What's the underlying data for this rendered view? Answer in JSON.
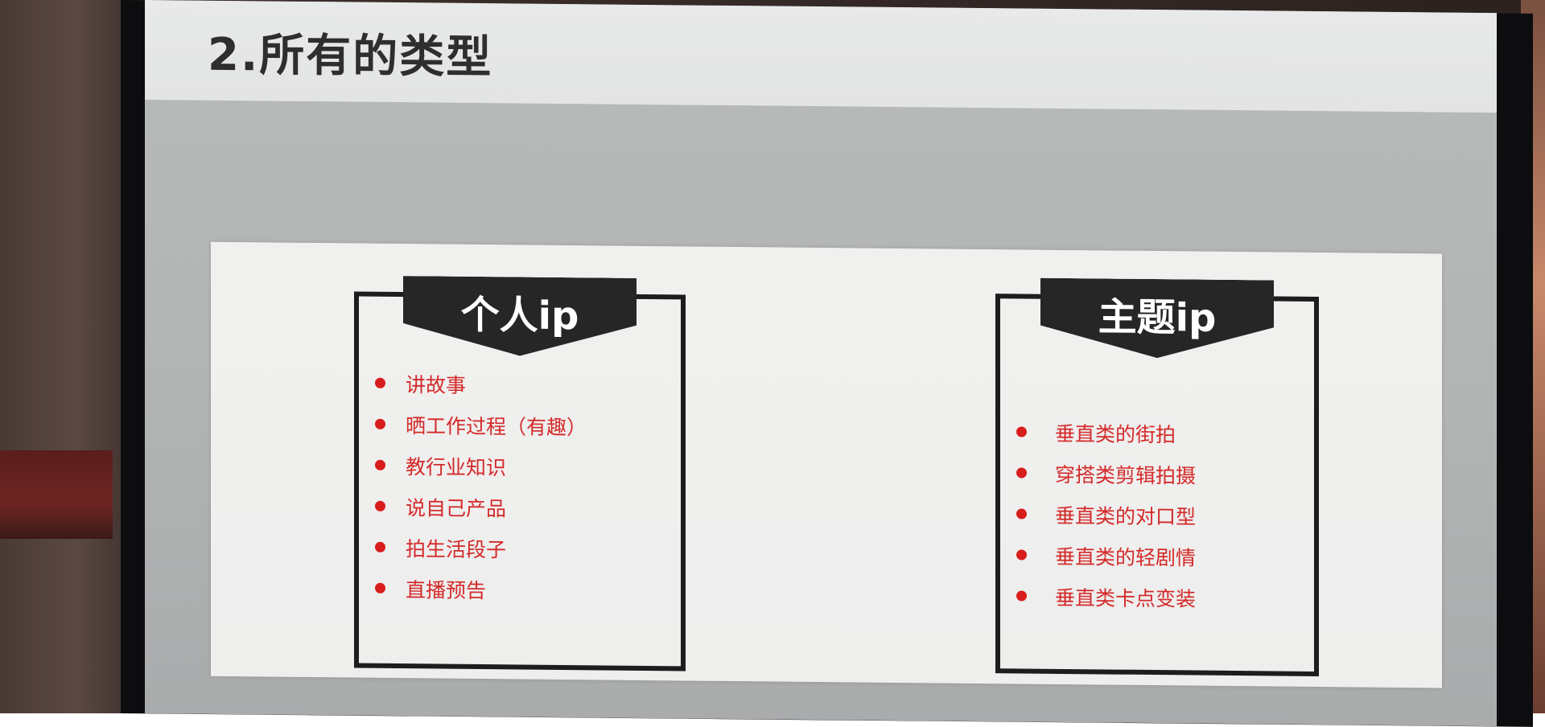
{
  "slide": {
    "title": "2.所有的类型"
  },
  "personal_ip": {
    "heading": "个人ip",
    "items": [
      "讲故事",
      "晒工作过程（有趣）",
      "教行业知识",
      "说自己产品",
      "拍生活段子",
      "直播预告"
    ]
  },
  "theme_ip": {
    "heading": "主题ip",
    "items": [
      "垂直类的街拍",
      "穿搭类剪辑拍摄",
      "垂直类的对口型",
      "垂直类的轻剧情",
      "垂直类卡点变装"
    ]
  },
  "colors": {
    "title_text": "#2e2e2e",
    "banner_bg": "#262626",
    "bullet": "#d81d1d",
    "item_text": "#d42a2a"
  }
}
